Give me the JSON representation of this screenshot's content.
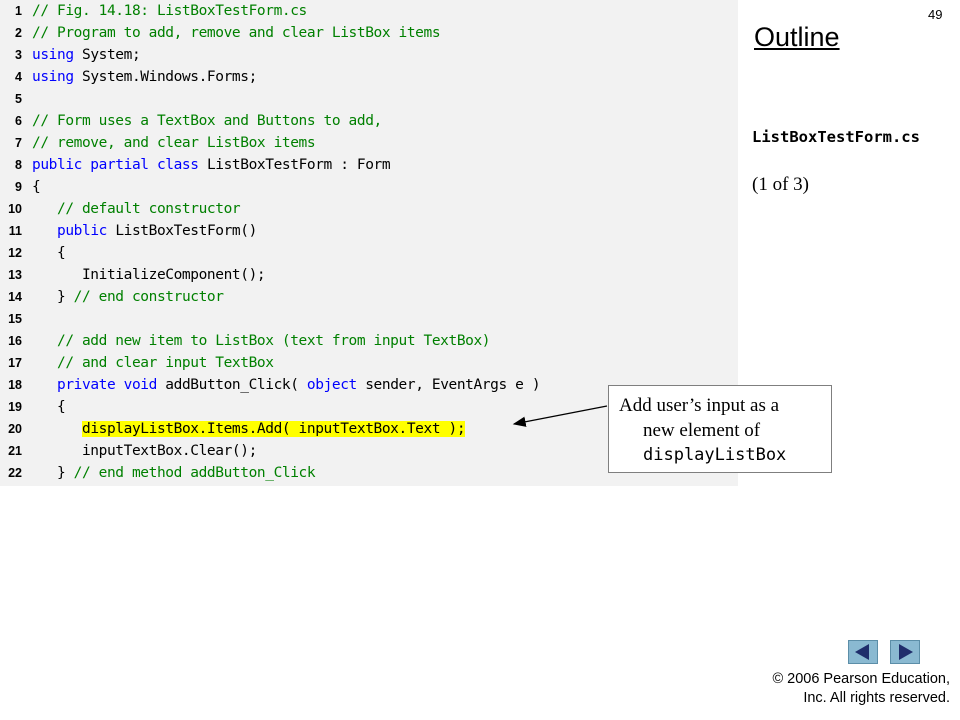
{
  "slide": {
    "number": "49",
    "outline_label": "Outline",
    "filename": "ListBoxTestForm.cs",
    "page_of": "(1 of 3)"
  },
  "code_lines": [
    {
      "num": "1",
      "text": "// Fig. 14.18: ListBoxTestForm.cs"
    },
    {
      "num": "2",
      "text": "// Program to add, remove and clear ListBox items"
    },
    {
      "num": "3",
      "text": "using System;"
    },
    {
      "num": "4",
      "text": "using System.Windows.Forms;"
    },
    {
      "num": "5",
      "text": ""
    },
    {
      "num": "6",
      "text": "// Form uses a TextBox and Buttons to add,"
    },
    {
      "num": "7",
      "text": "// remove, and clear ListBox items"
    },
    {
      "num": "8",
      "text": "public partial class ListBoxTestForm : Form"
    },
    {
      "num": "9",
      "text": "{"
    },
    {
      "num": "10",
      "text": "   // default constructor"
    },
    {
      "num": "11",
      "text": "   public ListBoxTestForm()"
    },
    {
      "num": "12",
      "text": "   {"
    },
    {
      "num": "13",
      "text": "      InitializeComponent();"
    },
    {
      "num": "14",
      "text": "   } // end constructor"
    },
    {
      "num": "15",
      "text": ""
    },
    {
      "num": "16",
      "text": "   // add new item to ListBox (text from input TextBox)"
    },
    {
      "num": "17",
      "text": "   // and clear input TextBox"
    },
    {
      "num": "18",
      "text": "   private void addButton_Click( object sender, EventArgs e )"
    },
    {
      "num": "19",
      "text": "   {"
    },
    {
      "num": "20",
      "text": "      displayListBox.Items.Add( inputTextBox.Text );"
    },
    {
      "num": "21",
      "text": "      inputTextBox.Clear();"
    },
    {
      "num": "22",
      "text": "   } // end method addButton_Click"
    }
  ],
  "callout": {
    "line1": "Add user’s input as a",
    "line2": "new element of",
    "line3": "displayListBox"
  },
  "navigation": {
    "prev_icon": "triangle-left-icon",
    "next_icon": "triangle-right-icon"
  },
  "footer": {
    "copyright_line1": "© 2006 Pearson Education,",
    "copyright_line2": "Inc.  All rights reserved."
  },
  "colors": {
    "comment": "#008000",
    "keyword": "#0000ff",
    "highlight": "#ffff00",
    "code_background": "#f2f2f2",
    "nav_button": "#8ab9d1"
  }
}
